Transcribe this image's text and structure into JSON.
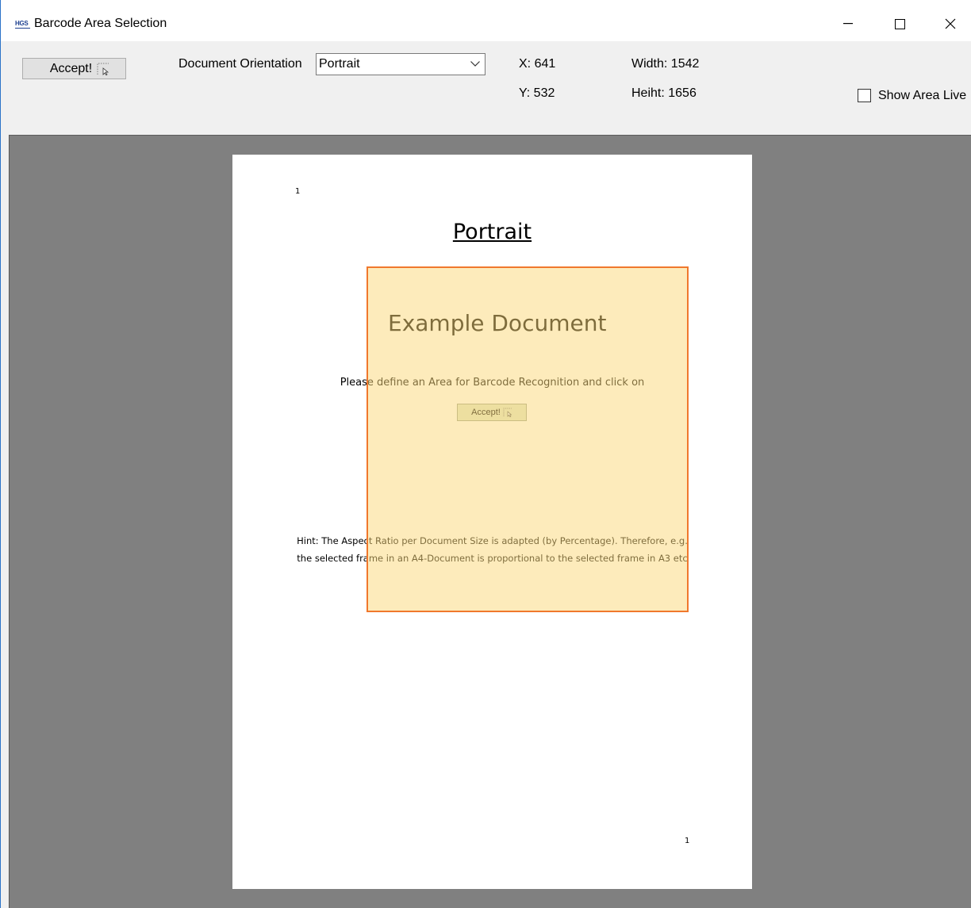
{
  "window": {
    "icon_text": "HGS",
    "title": "Barcode Area Selection"
  },
  "toolbar": {
    "accept_label": "Accept!",
    "orientation_label": "Document Orientation",
    "orientation_value": "Portrait",
    "x_label": "X: 641",
    "y_label": "Y: 532",
    "width_label": "Width: 1542",
    "height_label": "Heiht: 1656",
    "show_area_live_label": "Show Area Live",
    "show_area_live_checked": false
  },
  "document": {
    "page_number_top": "1",
    "page_number_bottom": "1",
    "title": "Portrait",
    "heading": "Example Document",
    "instruction": "Please define an Area for Barcode Recognition and click on",
    "inline_accept_label": "Accept!",
    "hint_line1": "Hint: The Aspect Ratio per Document Size is adapted (by Percentage). Therefore, e.g.",
    "hint_line2": "the selected frame in an A4-Document is proportional to the selected frame in A3 etc"
  },
  "colors": {
    "selection_fill": "#fcd778",
    "selection_border": "#f0782d",
    "canvas_background": "#808080"
  }
}
